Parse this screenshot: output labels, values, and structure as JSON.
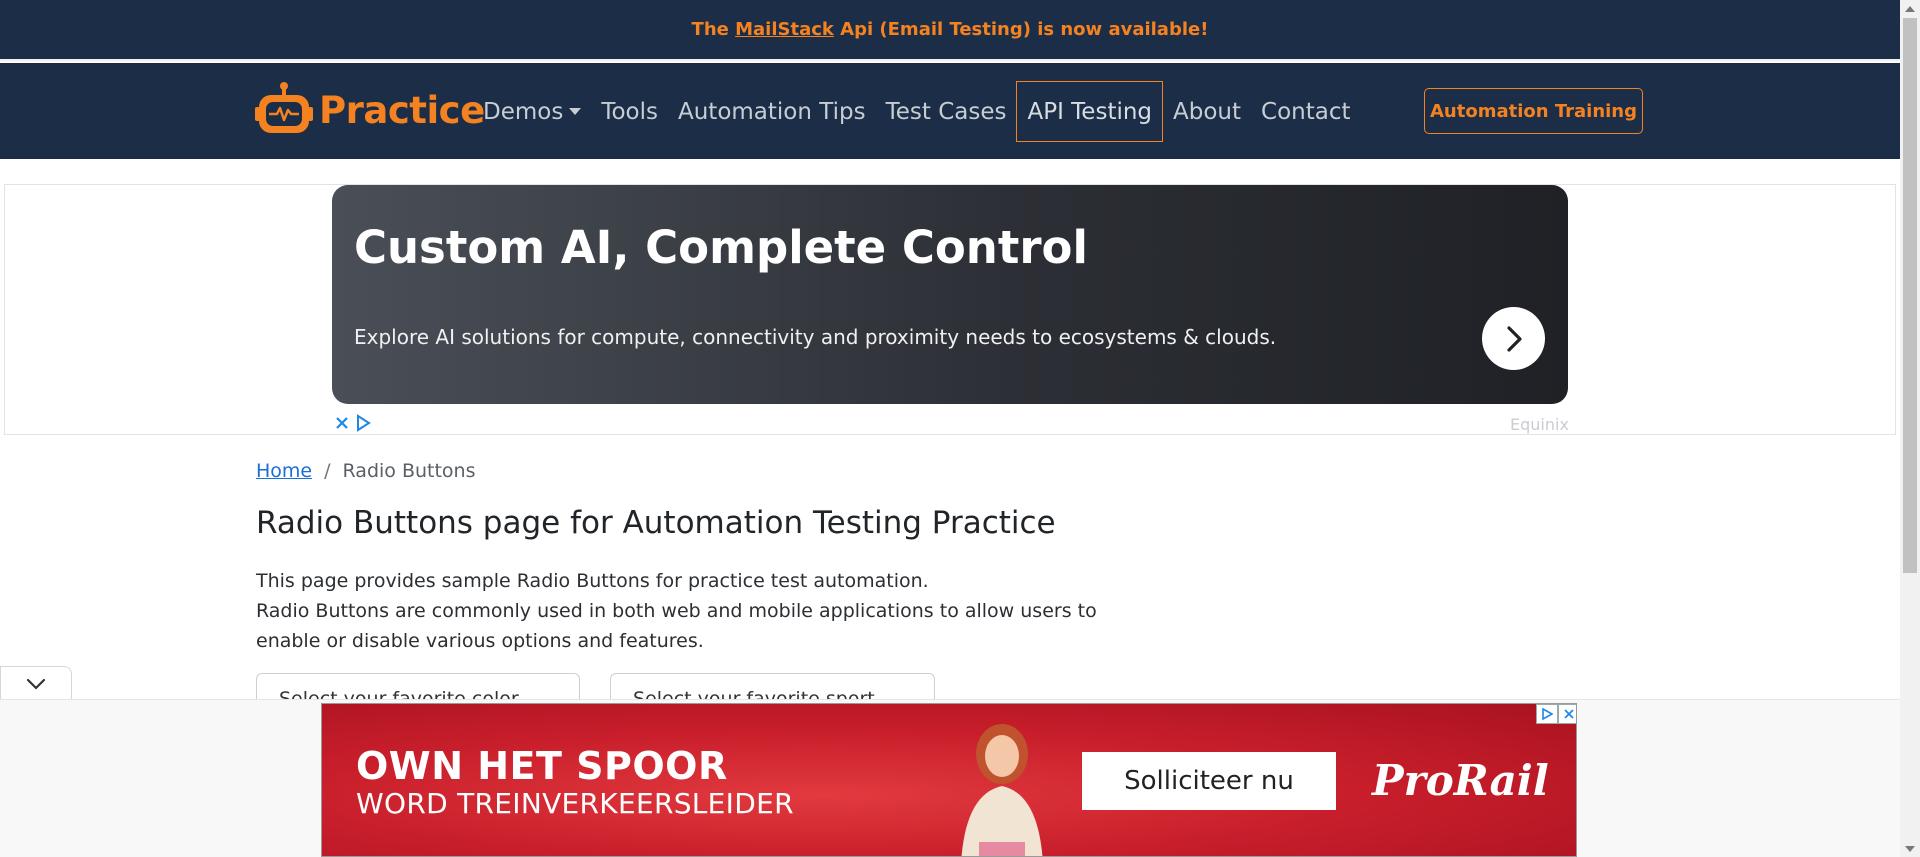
{
  "announcement": {
    "prefix": "The ",
    "link": "MailStack",
    "suffix": " Api (Email Testing) is now available!"
  },
  "navbar": {
    "brand": "Practice",
    "links": {
      "demos": "Demos",
      "tools": "Tools",
      "automation_tips": "Automation Tips",
      "test_cases": "Test Cases",
      "api_testing": "API Testing",
      "about": "About",
      "contact": "Contact"
    },
    "training_button": "Automation Training"
  },
  "top_ad": {
    "title": "Custom AI, Complete Control",
    "subtitle": "Explore AI solutions for compute, connectivity and proximity needs to ecosystems & clouds.",
    "sponsor": "Equinix"
  },
  "breadcrumb": {
    "home": "Home",
    "separator": "/",
    "current": "Radio Buttons"
  },
  "page": {
    "title": "Radio Buttons page for Automation Testing Practice",
    "intro_line1": "This page provides sample Radio Buttons for practice test automation.",
    "intro_line2": "Radio Buttons are commonly used in both web and mobile applications to allow users to enable or disable various options and features.",
    "box1_label": "Select your favorite color",
    "box2_label": "Select your favorite sport"
  },
  "bottom_ad": {
    "line1": "OWN HET SPOOR",
    "line2": "WORD TREINVERKEERSLEIDER",
    "cta": "Solliciteer nu",
    "brand": "ProRail"
  },
  "colors": {
    "navy": "#1b2d47",
    "accent_orange": "#f58220",
    "link_blue": "#1a6fd6",
    "ad_red": "#c81e2b"
  }
}
